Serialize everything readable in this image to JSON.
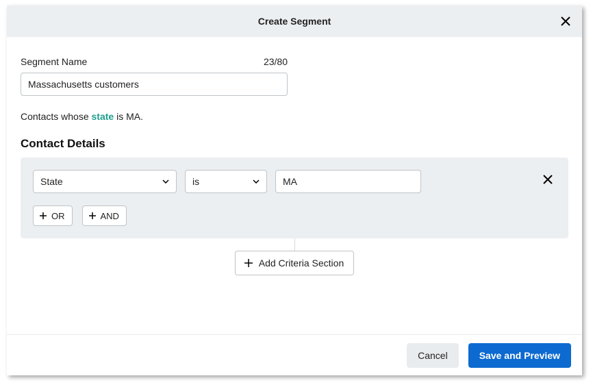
{
  "header": {
    "title": "Create Segment"
  },
  "segmentName": {
    "label": "Segment Name",
    "counter": "23/80",
    "value": "Massachusetts customers"
  },
  "description": {
    "prefix": "Contacts whose ",
    "highlight": "state",
    "suffix": " is MA."
  },
  "section": {
    "title": "Contact Details"
  },
  "criteria": {
    "field": "State",
    "operator": "is",
    "value": "MA",
    "orLabel": "OR",
    "andLabel": "AND"
  },
  "addSection": {
    "label": "Add Criteria Section"
  },
  "footer": {
    "cancel": "Cancel",
    "save": "Save and Preview"
  }
}
